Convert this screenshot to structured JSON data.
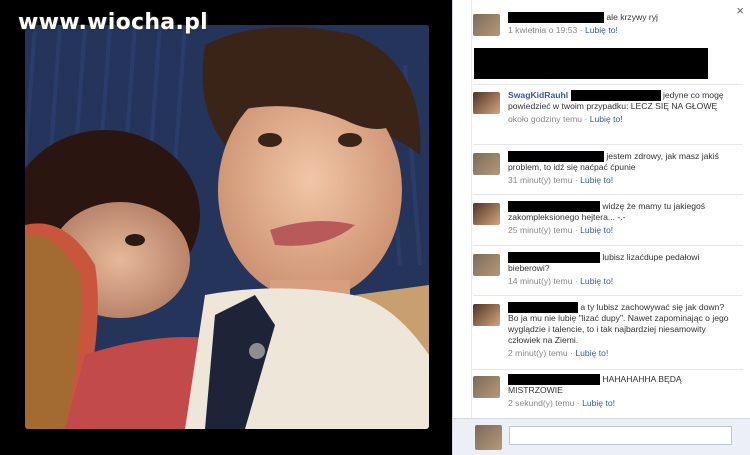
{
  "watermark": "www.wiocha.pl",
  "panel": {
    "close_icon_label": "×",
    "comments": [
      {
        "author": "",
        "text": "ale krzywy ryj",
        "time": "1 kwietnia o 19:53",
        "like": "Lubię to!"
      },
      {
        "author": "SwagKidRauhl",
        "text": "jedyne co mogę powiedzieć w twoim przypadku: LECZ SIĘ NA GŁOWĘ",
        "time": "około godziny temu",
        "like": "Lubię to!"
      },
      {
        "author": "",
        "text": "jestem zdrowy, jak masz jakiś problem, to idź się naćpać ćpunie",
        "time": "31 minut(y) temu",
        "like": "Lubię to!"
      },
      {
        "author": "",
        "text": "widzę że mamy tu jakiegoś zakompleksionego hejtera... -.-",
        "time": "25 minut(y) temu",
        "like": "Lubię to!"
      },
      {
        "author": "",
        "text": "lubisz lizaćdupe pedałowi bieberowi?",
        "time": "14 minut(y) temu",
        "like": "Lubię to!"
      },
      {
        "author": "",
        "text": "a ty lubisz zachowywać się jak down? Bo ja mu nie lubię \"lizać dupy\". Nawet zapominając o jego wyglądzie i talencie, to i tak najbardziej niesamowity człowiek na Ziemi.",
        "time": "2 minut(y) temu",
        "like": "Lubię to!"
      },
      {
        "author": "",
        "text": "HAHAHAHHA BĘDĄ MISTRZOWIE",
        "time": "2 sekund(y) temu",
        "like": "Lubię to!"
      }
    ],
    "separator": "·",
    "write_comment_value": ""
  }
}
